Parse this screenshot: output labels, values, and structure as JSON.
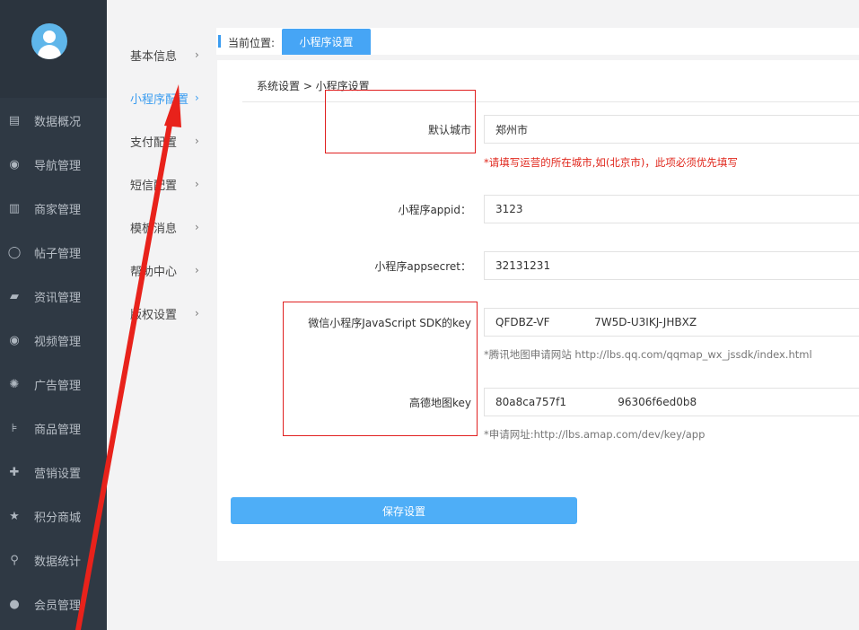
{
  "sidebar": {
    "items": [
      {
        "label": "数据概况",
        "icon": "▤",
        "icon_name": "dashboard-icon"
      },
      {
        "label": "导航管理",
        "icon": "◉",
        "icon_name": "compass-icon"
      },
      {
        "label": "商家管理",
        "icon": "▥",
        "icon_name": "bank-icon"
      },
      {
        "label": "帖子管理",
        "icon": "◯",
        "icon_name": "chat-bubble-icon"
      },
      {
        "label": "资讯管理",
        "icon": "▰",
        "icon_name": "book-icon"
      },
      {
        "label": "视频管理",
        "icon": "◉",
        "icon_name": "video-icon"
      },
      {
        "label": "广告管理",
        "icon": "✺",
        "icon_name": "lifebuoy-icon"
      },
      {
        "label": "商品管理",
        "icon": "⊧",
        "icon_name": "cart-icon"
      },
      {
        "label": "营销设置",
        "icon": "✚",
        "icon_name": "gift-icon"
      },
      {
        "label": "积分商城",
        "icon": "★",
        "icon_name": "star-icon"
      },
      {
        "label": "数据统计",
        "icon": "⚲",
        "icon_name": "key-icon"
      },
      {
        "label": "会员管理",
        "icon": "●",
        "icon_name": "user-icon"
      }
    ]
  },
  "submenu": {
    "items": [
      {
        "label": "基本信息",
        "active": false
      },
      {
        "label": "小程序配置",
        "active": true
      },
      {
        "label": "支付配置",
        "active": false
      },
      {
        "label": "短信配置",
        "active": false
      },
      {
        "label": "模板消息",
        "active": false
      },
      {
        "label": "帮助中心",
        "active": false
      },
      {
        "label": "版权设置",
        "active": false
      }
    ],
    "chevron": "›"
  },
  "header": {
    "position_label": "当前位置:",
    "current_tab": "小程序设置"
  },
  "breadcrumb": "系统设置 > 小程序设置",
  "form": {
    "city": {
      "label": "默认城市",
      "value": "郑州市",
      "hint": "*请填写运营的所在城市,如(北京市)，此项必须优先填写"
    },
    "appid": {
      "label": "小程序appid：",
      "value": "3123"
    },
    "appsecret": {
      "label": "小程序appsecret：",
      "value": "32131231"
    },
    "js_sdk_key": {
      "label": "微信小程序JavaScript SDK的key",
      "value": "QFDBZ-VF             7W5D-U3IKJ-JHBXZ",
      "hint": "*腾讯地图申请网站 http://lbs.qq.com/qqmap_wx_jssdk/index.html"
    },
    "amap_key": {
      "label": "高德地图key",
      "value": "80a8ca757f1               96306f6ed0b8",
      "hint": "*申请网址:http://lbs.amap.com/dev/key/app"
    }
  },
  "save_button": "保存设置",
  "colors": {
    "sidebar_bg": "#2f3944",
    "accent": "#46a5f5",
    "annotation_red": "#e02020",
    "hint_red": "#e0261b"
  }
}
